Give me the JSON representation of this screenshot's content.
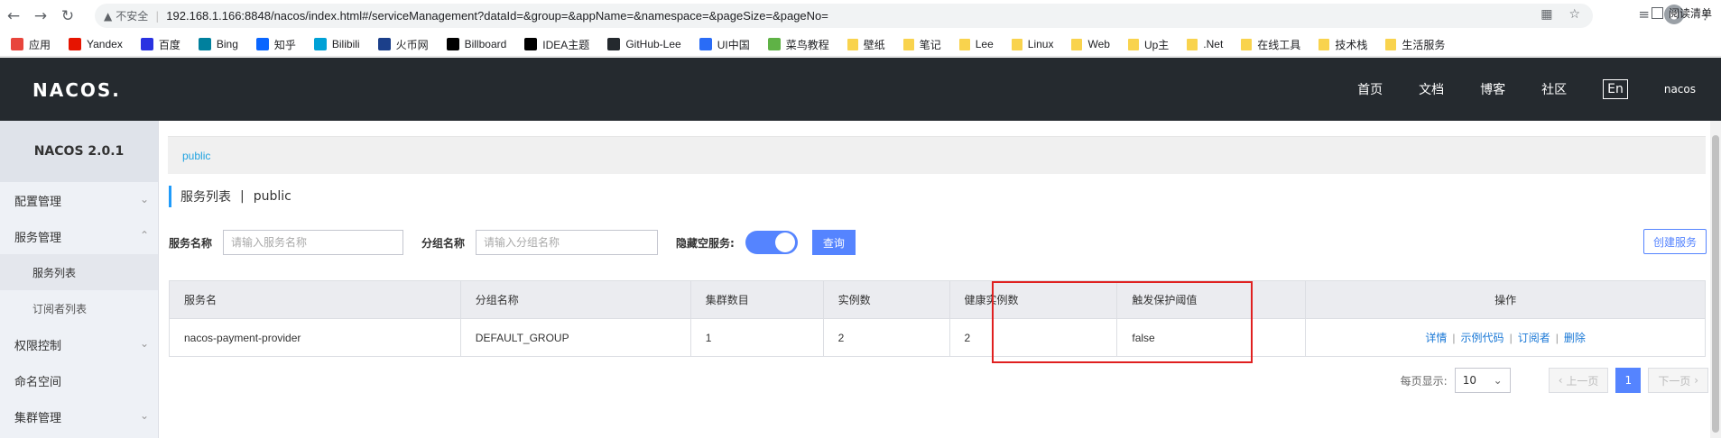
{
  "browser": {
    "insecure_label": "不安全",
    "url": "192.168.1.166:8848/nacos/index.html#/serviceManagement?dataId=&group=&appName=&namespace=&pageSize=&pageNo="
  },
  "bookmarks": [
    {
      "label": "应用",
      "icon": "apps-grid-icon",
      "color": "#e8453c"
    },
    {
      "label": "Yandex",
      "icon": "yandex-icon",
      "color": "#e61400"
    },
    {
      "label": "百度",
      "icon": "baidu-paw-icon",
      "color": "#2932e1"
    },
    {
      "label": "Bing",
      "icon": "bing-icon",
      "color": "#00809d"
    },
    {
      "label": "知乎",
      "icon": "zhihu-icon",
      "color": "#0a66ff"
    },
    {
      "label": "Bilibili",
      "icon": "bilibili-icon",
      "color": "#00a1d6"
    },
    {
      "label": "火币网",
      "icon": "huobi-icon",
      "color": "#1b3f8a"
    },
    {
      "label": "Billboard",
      "icon": "billboard-icon",
      "color": "#000000"
    },
    {
      "label": "IDEA主题",
      "icon": "idea-icon",
      "color": "#000000"
    },
    {
      "label": "GitHub-Lee",
      "icon": "github-icon",
      "color": "#24292e"
    },
    {
      "label": "UI中国",
      "icon": "uichina-icon",
      "color": "#2a6cf6"
    },
    {
      "label": "菜鸟教程",
      "icon": "runoob-icon",
      "color": "#5fb246"
    },
    {
      "label": "壁纸",
      "icon": "folder-icon",
      "color": "#f9d34d"
    },
    {
      "label": "笔记",
      "icon": "folder-icon",
      "color": "#f9d34d"
    },
    {
      "label": "Lee",
      "icon": "folder-icon",
      "color": "#f9d34d"
    },
    {
      "label": "Linux",
      "icon": "folder-icon",
      "color": "#f9d34d"
    },
    {
      "label": "Web",
      "icon": "folder-icon",
      "color": "#f9d34d"
    },
    {
      "label": "Up主",
      "icon": "folder-icon",
      "color": "#f9d34d"
    },
    {
      "label": ".Net",
      "icon": "folder-icon",
      "color": "#f9d34d"
    },
    {
      "label": "在线工具",
      "icon": "folder-icon",
      "color": "#f9d34d"
    },
    {
      "label": "技术栈",
      "icon": "folder-icon",
      "color": "#f9d34d"
    },
    {
      "label": "生活服务",
      "icon": "folder-icon",
      "color": "#f9d34d"
    }
  ],
  "reading_list": "阅读清单",
  "header": {
    "logo": "NACOS.",
    "nav": [
      "首页",
      "文档",
      "博客",
      "社区"
    ],
    "lang": "En",
    "user": "nacos"
  },
  "sidebar": {
    "title": "NACOS 2.0.1",
    "items": [
      {
        "label": "配置管理",
        "expanded": false
      },
      {
        "label": "服务管理",
        "expanded": true,
        "children": [
          "服务列表",
          "订阅者列表"
        ]
      },
      {
        "label": "权限控制",
        "expanded": false
      },
      {
        "label": "命名空间"
      },
      {
        "label": "集群管理",
        "expanded": false
      }
    ]
  },
  "main": {
    "namespace": "public",
    "page_title": "服务列表",
    "page_title_ns": "public",
    "filters": {
      "service_label": "服务名称",
      "service_placeholder": "请输入服务名称",
      "group_label": "分组名称",
      "group_placeholder": "请输入分组名称",
      "hide_empty_label": "隐藏空服务:",
      "hide_empty_on": true,
      "query_label": "查询",
      "create_label": "创建服务"
    },
    "table": {
      "columns": [
        "服务名",
        "分组名称",
        "集群数目",
        "实例数",
        "健康实例数",
        "触发保护阈值",
        "操作"
      ],
      "rows": [
        {
          "service": "nacos-payment-provider",
          "group": "DEFAULT_GROUP",
          "clusters": "1",
          "instances": "2",
          "healthy": "2",
          "threshold": "false",
          "ops": [
            "详情",
            "示例代码",
            "订阅者",
            "删除"
          ]
        }
      ]
    },
    "pagination": {
      "per_page_label": "每页显示:",
      "per_page": "10",
      "prev": "上一页",
      "current": "1",
      "next": "下一页"
    },
    "highlight_color": "#e02020"
  }
}
